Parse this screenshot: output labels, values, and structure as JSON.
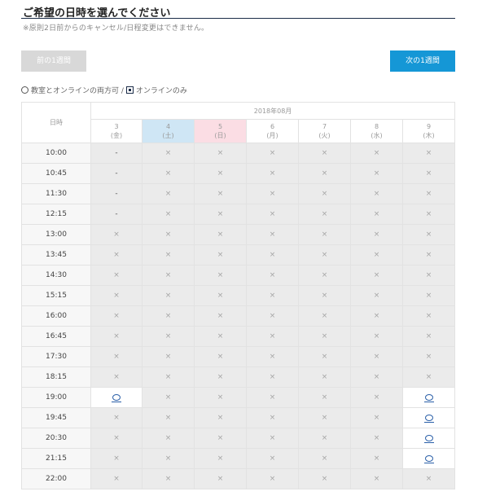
{
  "header": {
    "title": "ご希望の日時を選んでください",
    "note": "※原則2日前からのキャンセル/日程変更はできません。"
  },
  "nav": {
    "prev_label": "前の1週間",
    "next_label": "次の1週間"
  },
  "legend": {
    "circle_label": "教室とオンラインの両方可 /",
    "online_label": "オンラインのみ"
  },
  "calendar": {
    "date_header": "日時",
    "month_label": "2018年08月",
    "days": [
      {
        "num": "3",
        "dow": "(金)",
        "kind": ""
      },
      {
        "num": "4",
        "dow": "(土)",
        "kind": "sat"
      },
      {
        "num": "5",
        "dow": "(日)",
        "kind": "sun"
      },
      {
        "num": "6",
        "dow": "(月)",
        "kind": ""
      },
      {
        "num": "7",
        "dow": "(火)",
        "kind": ""
      },
      {
        "num": "8",
        "dow": "(水)",
        "kind": ""
      },
      {
        "num": "9",
        "dow": "(木)",
        "kind": ""
      }
    ],
    "rows": [
      {
        "time": "10:00",
        "slots": [
          "-",
          "×",
          "×",
          "×",
          "×",
          "×",
          "×"
        ]
      },
      {
        "time": "10:45",
        "slots": [
          "-",
          "×",
          "×",
          "×",
          "×",
          "×",
          "×"
        ]
      },
      {
        "time": "11:30",
        "slots": [
          "-",
          "×",
          "×",
          "×",
          "×",
          "×",
          "×"
        ]
      },
      {
        "time": "12:15",
        "slots": [
          "-",
          "×",
          "×",
          "×",
          "×",
          "×",
          "×"
        ]
      },
      {
        "time": "13:00",
        "slots": [
          "×",
          "×",
          "×",
          "×",
          "×",
          "×",
          "×"
        ]
      },
      {
        "time": "13:45",
        "slots": [
          "×",
          "×",
          "×",
          "×",
          "×",
          "×",
          "×"
        ]
      },
      {
        "time": "14:30",
        "slots": [
          "×",
          "×",
          "×",
          "×",
          "×",
          "×",
          "×"
        ]
      },
      {
        "time": "15:15",
        "slots": [
          "×",
          "×",
          "×",
          "×",
          "×",
          "×",
          "×"
        ]
      },
      {
        "time": "16:00",
        "slots": [
          "×",
          "×",
          "×",
          "×",
          "×",
          "×",
          "×"
        ]
      },
      {
        "time": "16:45",
        "slots": [
          "×",
          "×",
          "×",
          "×",
          "×",
          "×",
          "×"
        ]
      },
      {
        "time": "17:30",
        "slots": [
          "×",
          "×",
          "×",
          "×",
          "×",
          "×",
          "×"
        ]
      },
      {
        "time": "18:15",
        "slots": [
          "×",
          "×",
          "×",
          "×",
          "×",
          "×",
          "×"
        ]
      },
      {
        "time": "19:00",
        "slots": [
          "O",
          "×",
          "×",
          "×",
          "×",
          "×",
          "O"
        ]
      },
      {
        "time": "19:45",
        "slots": [
          "×",
          "×",
          "×",
          "×",
          "×",
          "×",
          "O"
        ]
      },
      {
        "time": "20:30",
        "slots": [
          "×",
          "×",
          "×",
          "×",
          "×",
          "×",
          "O"
        ]
      },
      {
        "time": "21:15",
        "slots": [
          "×",
          "×",
          "×",
          "×",
          "×",
          "×",
          "O"
        ]
      },
      {
        "time": "22:00",
        "slots": [
          "×",
          "×",
          "×",
          "×",
          "×",
          "×",
          "×"
        ]
      }
    ]
  }
}
